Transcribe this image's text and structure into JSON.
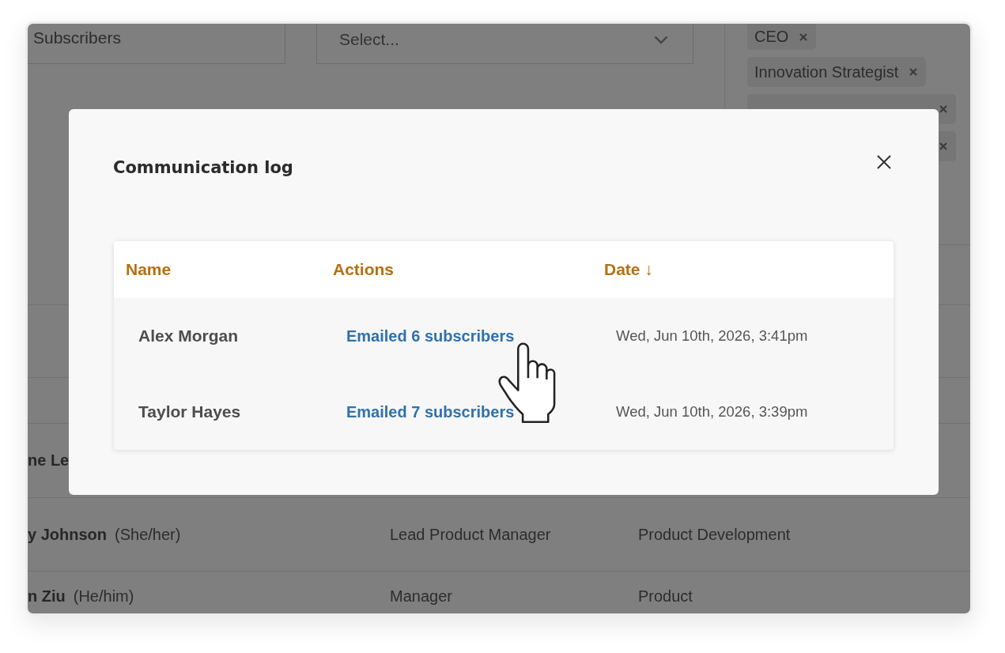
{
  "background": {
    "search_field": {
      "value": "Subscribers"
    },
    "select": {
      "placeholder": "Select..."
    },
    "tags": [
      {
        "kind": "labelled",
        "label": "CEO"
      },
      {
        "kind": "labelled",
        "label": "Innovation Strategist"
      },
      {
        "kind": "covered"
      },
      {
        "kind": "covered"
      }
    ],
    "rows": [
      {
        "name": "ne Le"
      },
      {
        "name": "y Johnson",
        "pronouns": "(She/her)",
        "column_2": "Lead Product Manager",
        "column_3": "Product Development"
      },
      {
        "name": "n Ziu",
        "pronouns": "(He/him)",
        "column_2": "Manager",
        "column_3": "Product"
      }
    ]
  },
  "modal": {
    "title": "Communication log",
    "columns": [
      {
        "label": "Name"
      },
      {
        "label": "Actions"
      },
      {
        "label": "Date ↓"
      }
    ],
    "rows": [
      {
        "name": "Alex Morgan",
        "action": "Emailed 6 subscribers",
        "date": "Wed, Jun 10th, 2026, 3:41pm"
      },
      {
        "name": "Taylor Hayes",
        "action": "Emailed 7 subscribers",
        "date": "Wed, Jun 10th, 2026, 3:39pm"
      }
    ]
  }
}
